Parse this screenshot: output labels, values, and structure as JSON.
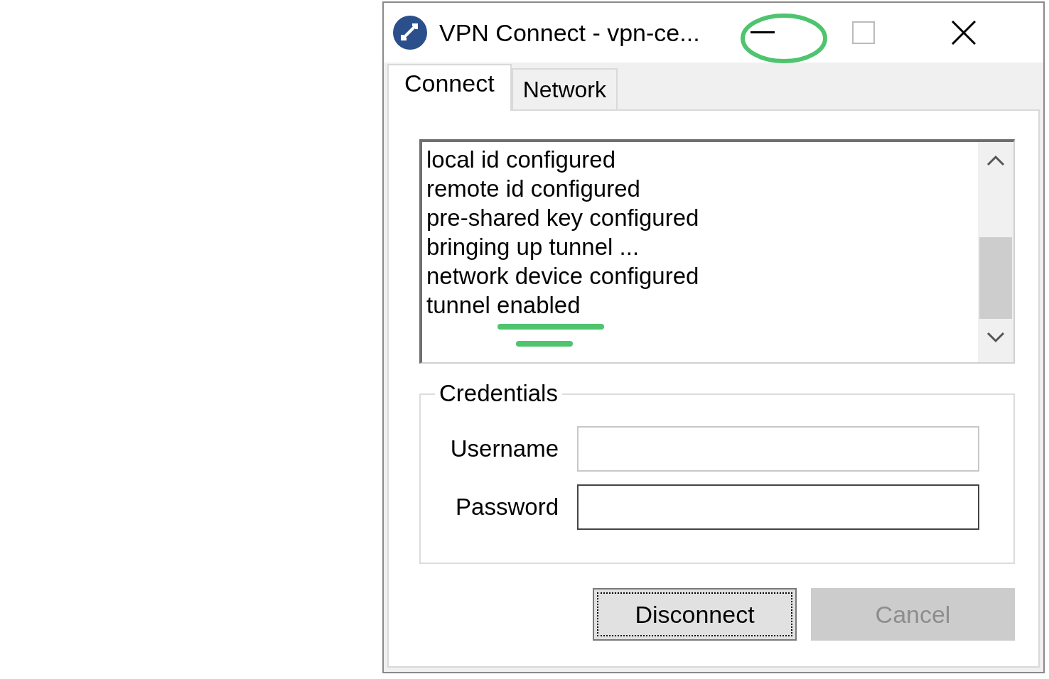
{
  "window": {
    "title": "VPN Connect - vpn-ce..."
  },
  "tabs": [
    {
      "label": "Connect",
      "selected": true
    },
    {
      "label": "Network",
      "selected": false
    }
  ],
  "log": [
    "local id configured",
    "remote id configured",
    "pre-shared key configured",
    "bringing up tunnel ...",
    "network device configured",
    "tunnel enabled"
  ],
  "credentials": {
    "title": "Credentials",
    "fields": [
      {
        "label": "Username",
        "focused": false
      },
      {
        "label": "Password",
        "focused": true
      }
    ]
  },
  "buttons": [
    {
      "label": "Disconnect",
      "disabled": false,
      "focused": true
    },
    {
      "label": "Cancel",
      "disabled": true,
      "focused": false
    }
  ]
}
